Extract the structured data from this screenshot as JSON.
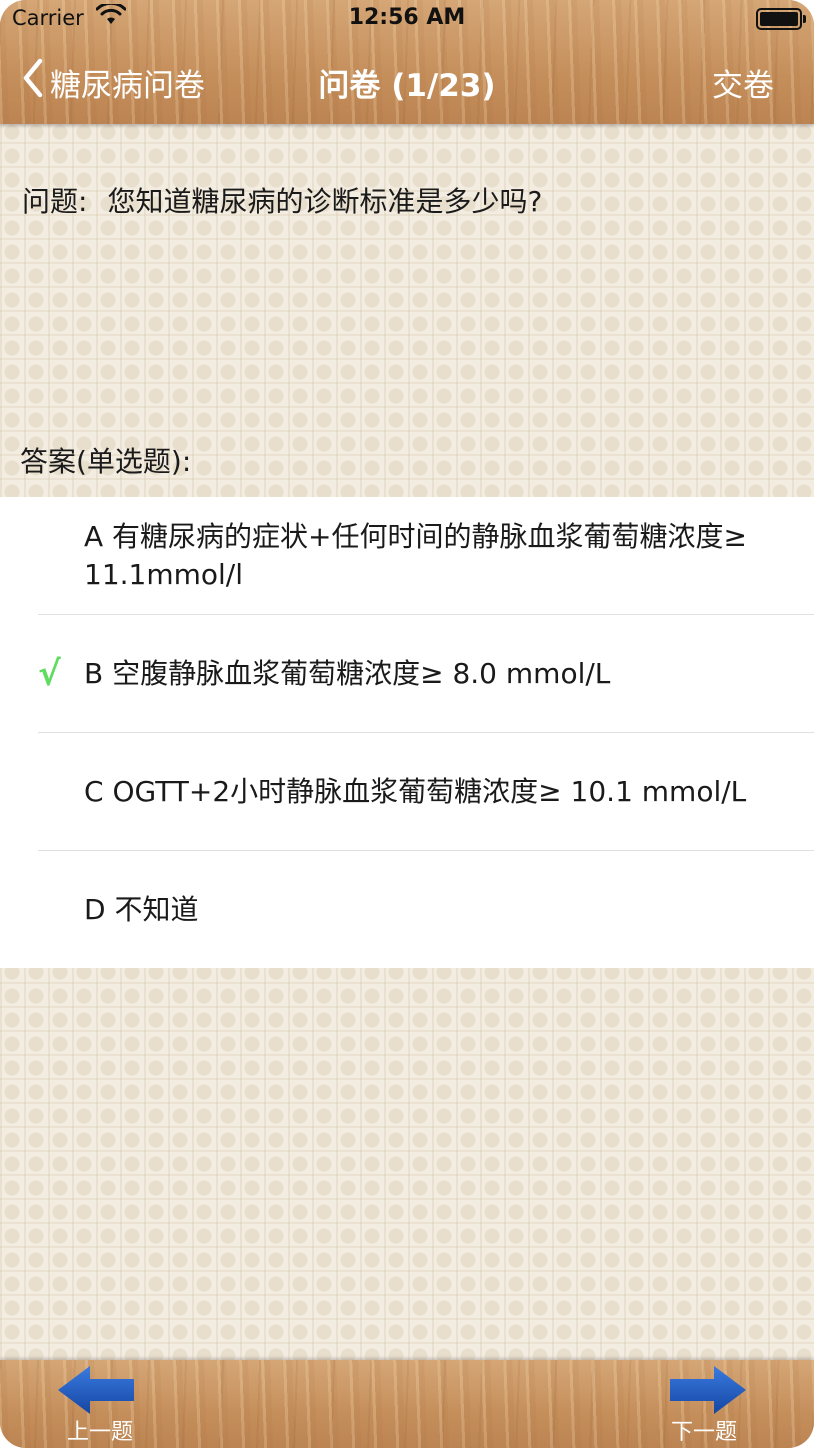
{
  "status_bar": {
    "carrier": "Carrier",
    "time": "12:56 AM"
  },
  "nav": {
    "back_label": "糖尿病问卷",
    "title": "问卷 (1/23)",
    "submit_label": "交卷"
  },
  "question": {
    "label": "问题:",
    "text": "您知道糖尿病的诊断标准是多少吗?"
  },
  "answer_header": "答案(单选题):",
  "options": [
    {
      "text": "A 有糖尿病的症状+任何时间的静脉血浆葡萄糖浓度≥ 11.1mmol/l",
      "selected": false
    },
    {
      "text": "B 空腹静脉血浆葡萄糖浓度≥ 8.0 mmol/L",
      "selected": true
    },
    {
      "text": "C OGTT+2小时静脉血浆葡萄糖浓度≥ 10.1 mmol/L",
      "selected": false
    },
    {
      "text": "D 不知道",
      "selected": false
    }
  ],
  "check_mark": "√",
  "bottom": {
    "prev_label": "上一题",
    "next_label": "下一题"
  },
  "colors": {
    "wood": "#c99564",
    "arrow_blue": "#1a56b8",
    "check_green": "#5fdc5f"
  },
  "icons": {
    "back": "chevron-left-icon",
    "prev": "arrow-left-icon",
    "next": "arrow-right-icon"
  }
}
